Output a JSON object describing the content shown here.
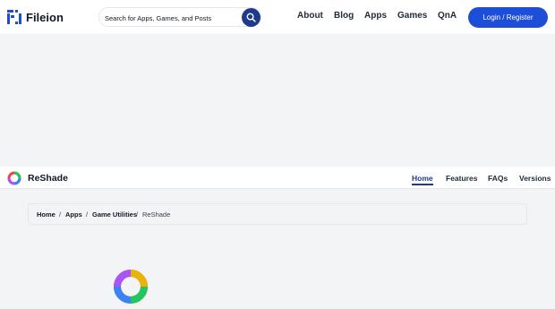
{
  "header": {
    "brand_name": "Fileion",
    "search_placeholder": "Search for Apps, Games, and Posts",
    "nav": [
      "About",
      "Blog",
      "Apps",
      "Games",
      "QnA"
    ],
    "login_label": "Login / Register",
    "accent_color": "#1d4ed8"
  },
  "app": {
    "name": "ReShade",
    "tabs": [
      "Home",
      "Features",
      "FAQs",
      "Versions"
    ],
    "active_tab": "Home"
  },
  "breadcrumb": {
    "items": [
      "Home",
      "Apps",
      "Game Utilities",
      "ReShade"
    ],
    "separator": "/"
  }
}
